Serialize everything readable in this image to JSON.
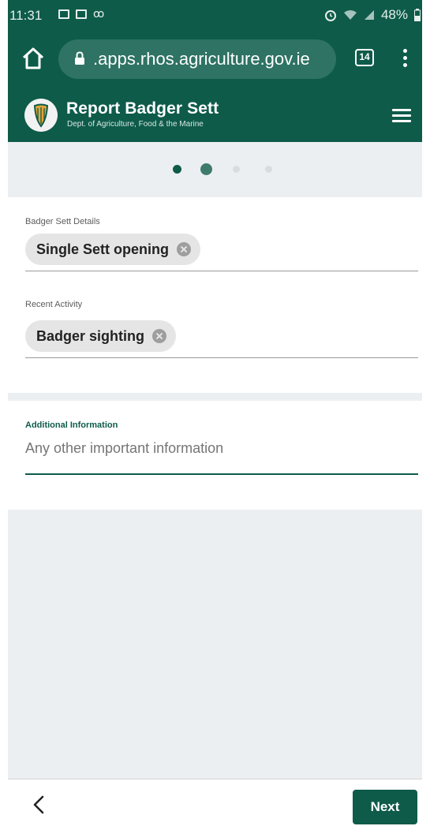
{
  "status_bar": {
    "time": "11:31",
    "battery": "48%",
    "icons": [
      "gallery-icon",
      "photo-icon",
      "voicemail-icon",
      "alarm-icon",
      "wifi-icon",
      "signal-icon",
      "battery-icon"
    ]
  },
  "browser": {
    "url": ".apps.rhos.agriculture.gov.ie",
    "tab_count": "14"
  },
  "app": {
    "title": "Report Badger Sett",
    "subtitle": "Dept. of Agriculture, Food & the Marine"
  },
  "progress": {
    "total_steps": 4,
    "current_step": 2
  },
  "form": {
    "sett_details": {
      "label": "Badger Sett Details",
      "chip": "Single Sett opening"
    },
    "recent_activity": {
      "label": "Recent Activity",
      "chip": "Badger sighting"
    },
    "additional_info": {
      "label": "Additional Information",
      "placeholder": "Any other important information"
    }
  },
  "footer": {
    "next_label": "Next"
  },
  "colors": {
    "brand": "#0e5b4a",
    "background": "#eceff1",
    "chip": "#e5e5e5"
  }
}
